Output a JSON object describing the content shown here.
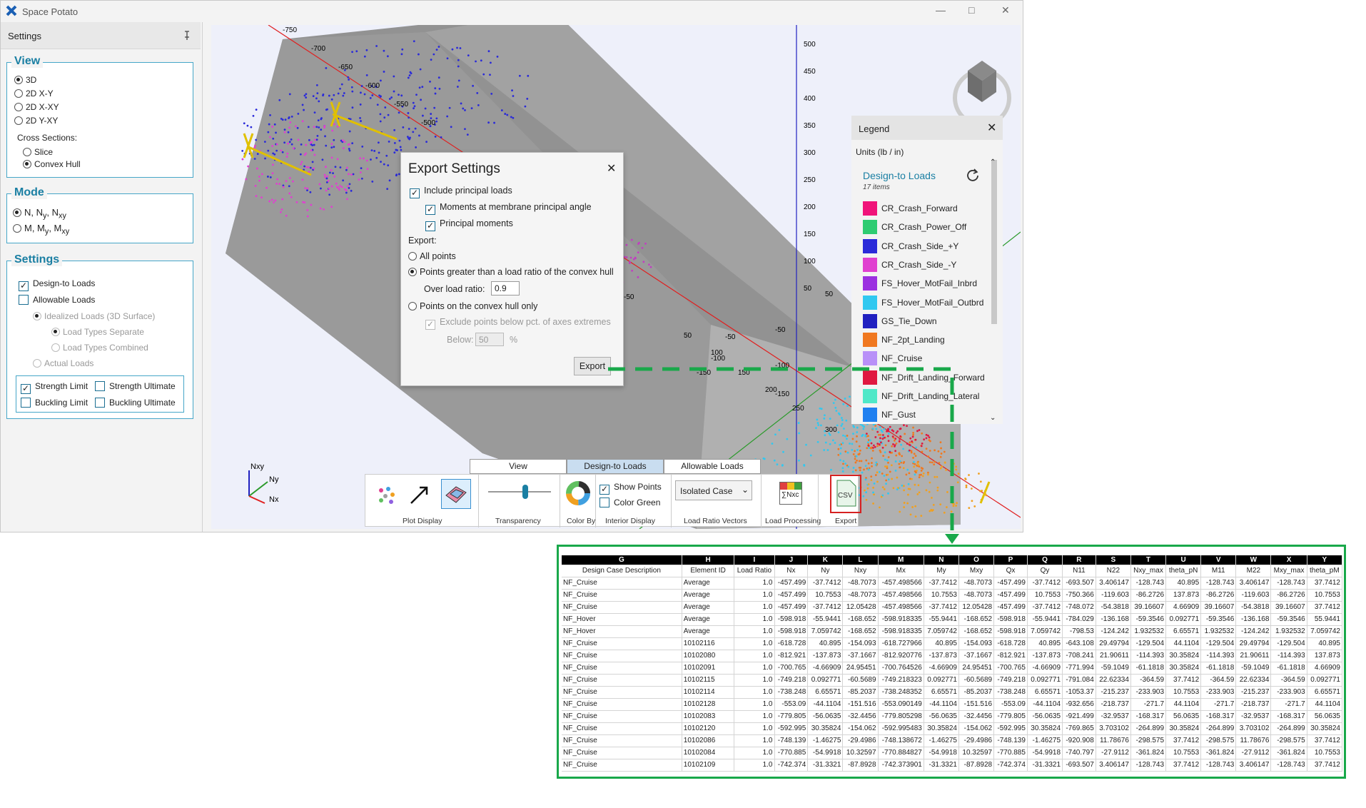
{
  "app": {
    "title": "Space Potato"
  },
  "sidebar": {
    "title": "Settings",
    "view": {
      "legend": "View",
      "options": [
        "3D",
        "2D X-Y",
        "2D X-XY",
        "2D Y-XY"
      ],
      "selected": 0,
      "cross_label": "Cross Sections:",
      "cross_options": [
        "Slice",
        "Convex Hull"
      ],
      "cross_selected": 1
    },
    "mode": {
      "legend": "Mode",
      "options": [
        {
          "main": "N",
          "sub": "",
          "parts": [
            "N, N",
            "y",
            ", N",
            "xy"
          ]
        },
        {
          "parts": [
            "M, M",
            "y",
            ", M",
            "xy"
          ]
        }
      ],
      "selected": 0
    },
    "settings": {
      "legend": "Settings",
      "design_to_loads": "Design-to Loads",
      "allowable_loads": "Allowable Loads",
      "idealized": "Idealized Loads (3D Surface)",
      "separate": "Load Types Separate",
      "combined": "Load Types Combined",
      "actual": "Actual Loads",
      "strength_limit": "Strength Limit",
      "strength_ultimate": "Strength Ultimate",
      "buckling_limit": "Buckling Limit",
      "buckling_ultimate": "Buckling Ultimate"
    }
  },
  "axes_labels": {
    "x_ticks": [
      "-750",
      "-700",
      "-650",
      "-600",
      "-550",
      "-500",
      "-250",
      "-200",
      "-150",
      "-100",
      "-50",
      "50",
      "100",
      "150",
      "200",
      "250",
      "300"
    ],
    "z_ticks": [
      "500",
      "450",
      "400",
      "350",
      "300",
      "250",
      "200",
      "150",
      "100",
      "50",
      "-50",
      "-100",
      "-150"
    ],
    "y_ticks": [
      "-50",
      "-100",
      "-150",
      "50",
      "100",
      "150",
      "200",
      "250",
      "-250",
      "-200",
      "-150",
      "-100"
    ]
  },
  "export_dialog": {
    "title": "Export Settings",
    "include_principal": "Include principal loads",
    "moments_membrane": "Moments at membrane principal angle",
    "principal_moments": "Principal moments",
    "export_label": "Export:",
    "all_points": "All points",
    "points_greater": "Points greater than a load ratio of the convex hull",
    "over_load_label": "Over load ratio:",
    "over_load_value": "0.9",
    "hull_only": "Points on the convex hull only",
    "exclude_below": "Exclude points below pct. of axes extremes",
    "below_label": "Below:",
    "below_value": "50",
    "pct": "%",
    "export_button": "Export"
  },
  "legend": {
    "title": "Legend",
    "units": "Units (lb / in)",
    "section": "Design-to Loads",
    "count": "17 items",
    "items": [
      {
        "label": "CR_Crash_Forward",
        "color": "#f0147a"
      },
      {
        "label": "CR_Crash_Power_Off",
        "color": "#2ecc71"
      },
      {
        "label": "CR_Crash_Side_+Y",
        "color": "#2b2bd9"
      },
      {
        "label": "CR_Crash_Side_-Y",
        "color": "#e040d0"
      },
      {
        "label": "FS_Hover_MotFail_Inbrd",
        "color": "#9b30e0"
      },
      {
        "label": "FS_Hover_MotFail_Outbrd",
        "color": "#30c8f0"
      },
      {
        "label": "GS_Tie_Down",
        "color": "#2020c0"
      },
      {
        "label": "NF_2pt_Landing",
        "color": "#f07820"
      },
      {
        "label": "NF_Cruise",
        "color": "#b890f8"
      },
      {
        "label": "NF_Drift_Landing_Forward",
        "color": "#e01840"
      },
      {
        "label": "NF_Drift_Landing_Lateral",
        "color": "#50e8c8"
      },
      {
        "label": "NF_Gust",
        "color": "#2080f0"
      }
    ]
  },
  "tabs": [
    "View",
    "Design-to Loads",
    "Allowable Loads"
  ],
  "toolbar": {
    "plot_display": "Plot Display",
    "transparency": "Transparency",
    "color_by": "Color By",
    "show_points": "Show Points",
    "color_green": "Color Green",
    "interior_display": "Interior Display",
    "isolated_case": "Isolated Case",
    "load_ratio_vectors": "Load Ratio Vectors",
    "load_processing": "Load Processing",
    "export": "Export",
    "csv": "CSV",
    "sum_text": "∑Nxc"
  },
  "triad": {
    "nxy": "Nxy",
    "ny": "Ny",
    "nx": "Nx"
  },
  "spreadsheet": {
    "col_letters": [
      "G",
      "H",
      "I",
      "J",
      "K",
      "L",
      "M",
      "N",
      "O",
      "P",
      "Q",
      "R",
      "S",
      "T",
      "U",
      "V",
      "W",
      "X",
      "Y"
    ],
    "headers": [
      "Design Case Description",
      "Element ID",
      "Load Ratio",
      "Nx",
      "Ny",
      "Nxy",
      "Mx",
      "My",
      "Mxy",
      "Qx",
      "Qy",
      "N11",
      "N22",
      "Nxy_max",
      "theta_pN",
      "M11",
      "M22",
      "Mxy_max",
      "theta_pM"
    ],
    "rows": [
      [
        "NF_Cruise",
        "Average",
        "1.0",
        "-457.499",
        "-37.7412",
        "-48.7073",
        "-457.498566",
        "-37.7412",
        "-48.7073",
        "-457.499",
        "-37.7412",
        "-693.507",
        "3.406147",
        "-128.743",
        "40.895",
        "-128.743",
        "3.406147",
        "-128.743",
        "37.7412"
      ],
      [
        "NF_Cruise",
        "Average",
        "1.0",
        "-457.499",
        "10.7553",
        "-48.7073",
        "-457.498566",
        "10.7553",
        "-48.7073",
        "-457.499",
        "10.7553",
        "-750.366",
        "-119.603",
        "-86.2726",
        "137.873",
        "-86.2726",
        "-119.603",
        "-86.2726",
        "10.7553"
      ],
      [
        "NF_Cruise",
        "Average",
        "1.0",
        "-457.499",
        "-37.7412",
        "12.05428",
        "-457.498566",
        "-37.7412",
        "12.05428",
        "-457.499",
        "-37.7412",
        "-748.072",
        "-54.3818",
        "39.16607",
        "4.66909",
        "39.16607",
        "-54.3818",
        "39.16607",
        "37.7412"
      ],
      [
        "NF_Hover",
        "Average",
        "1.0",
        "-598.918",
        "-55.9441",
        "-168.652",
        "-598.918335",
        "-55.9441",
        "-168.652",
        "-598.918",
        "-55.9441",
        "-784.029",
        "-136.168",
        "-59.3546",
        "0.092771",
        "-59.3546",
        "-136.168",
        "-59.3546",
        "55.9441"
      ],
      [
        "NF_Hover",
        "Average",
        "1.0",
        "-598.918",
        "7.059742",
        "-168.652",
        "-598.918335",
        "7.059742",
        "-168.652",
        "-598.918",
        "7.059742",
        "-798.53",
        "-124.242",
        "1.932532",
        "6.65571",
        "1.932532",
        "-124.242",
        "1.932532",
        "7.059742"
      ],
      [
        "NF_Cruise",
        "10102116",
        "1.0",
        "-618.728",
        "40.895",
        "-154.093",
        "-618.727966",
        "40.895",
        "-154.093",
        "-618.728",
        "40.895",
        "-643.108",
        "29.49794",
        "-129.504",
        "44.1104",
        "-129.504",
        "29.49794",
        "-129.504",
        "40.895"
      ],
      [
        "NF_Cruise",
        "10102080",
        "1.0",
        "-812.921",
        "-137.873",
        "-37.1667",
        "-812.920776",
        "-137.873",
        "-37.1667",
        "-812.921",
        "-137.873",
        "-708.241",
        "21.90611",
        "-114.393",
        "30.35824",
        "-114.393",
        "21.90611",
        "-114.393",
        "137.873"
      ],
      [
        "NF_Cruise",
        "10102091",
        "1.0",
        "-700.765",
        "-4.66909",
        "24.95451",
        "-700.764526",
        "-4.66909",
        "24.95451",
        "-700.765",
        "-4.66909",
        "-771.994",
        "-59.1049",
        "-61.1818",
        "30.35824",
        "-61.1818",
        "-59.1049",
        "-61.1818",
        "4.66909"
      ],
      [
        "NF_Cruise",
        "10102115",
        "1.0",
        "-749.218",
        "0.092771",
        "-60.5689",
        "-749.218323",
        "0.092771",
        "-60.5689",
        "-749.218",
        "0.092771",
        "-791.084",
        "22.62334",
        "-364.59",
        "37.7412",
        "-364.59",
        "22.62334",
        "-364.59",
        "0.092771"
      ],
      [
        "NF_Cruise",
        "10102114",
        "1.0",
        "-738.248",
        "6.65571",
        "-85.2037",
        "-738.248352",
        "6.65571",
        "-85.2037",
        "-738.248",
        "6.65571",
        "-1053.37",
        "-215.237",
        "-233.903",
        "10.7553",
        "-233.903",
        "-215.237",
        "-233.903",
        "6.65571"
      ],
      [
        "NF_Cruise",
        "10102128",
        "1.0",
        "-553.09",
        "-44.1104",
        "-151.516",
        "-553.090149",
        "-44.1104",
        "-151.516",
        "-553.09",
        "-44.1104",
        "-932.656",
        "-218.737",
        "-271.7",
        "44.1104",
        "-271.7",
        "-218.737",
        "-271.7",
        "44.1104"
      ],
      [
        "NF_Cruise",
        "10102083",
        "1.0",
        "-779.805",
        "-56.0635",
        "-32.4456",
        "-779.805298",
        "-56.0635",
        "-32.4456",
        "-779.805",
        "-56.0635",
        "-921.499",
        "-32.9537",
        "-168.317",
        "56.0635",
        "-168.317",
        "-32.9537",
        "-168.317",
        "56.0635"
      ],
      [
        "NF_Cruise",
        "10102120",
        "1.0",
        "-592.995",
        "30.35824",
        "-154.062",
        "-592.995483",
        "30.35824",
        "-154.062",
        "-592.995",
        "30.35824",
        "-769.865",
        "3.703102",
        "-264.899",
        "30.35824",
        "-264.899",
        "3.703102",
        "-264.899",
        "30.35824"
      ],
      [
        "NF_Cruise",
        "10102086",
        "1.0",
        "-748.139",
        "-1.46275",
        "-29.4986",
        "-748.138672",
        "-1.46275",
        "-29.4986",
        "-748.139",
        "-1.46275",
        "-920.908",
        "11.78676",
        "-298.575",
        "37.7412",
        "-298.575",
        "11.78676",
        "-298.575",
        "37.7412"
      ],
      [
        "NF_Cruise",
        "10102084",
        "1.0",
        "-770.885",
        "-54.9918",
        "10.32597",
        "-770.884827",
        "-54.9918",
        "10.32597",
        "-770.885",
        "-54.9918",
        "-740.797",
        "-27.9112",
        "-361.824",
        "10.7553",
        "-361.824",
        "-27.9112",
        "-361.824",
        "10.7553"
      ],
      [
        "NF_Cruise",
        "10102109",
        "1.0",
        "-742.374",
        "-31.3321",
        "-87.8928",
        "-742.373901",
        "-31.3321",
        "-87.8928",
        "-742.374",
        "-31.3321",
        "-693.507",
        "3.406147",
        "-128.743",
        "37.7412",
        "-128.743",
        "3.406147",
        "-128.743",
        "37.7412"
      ]
    ]
  }
}
